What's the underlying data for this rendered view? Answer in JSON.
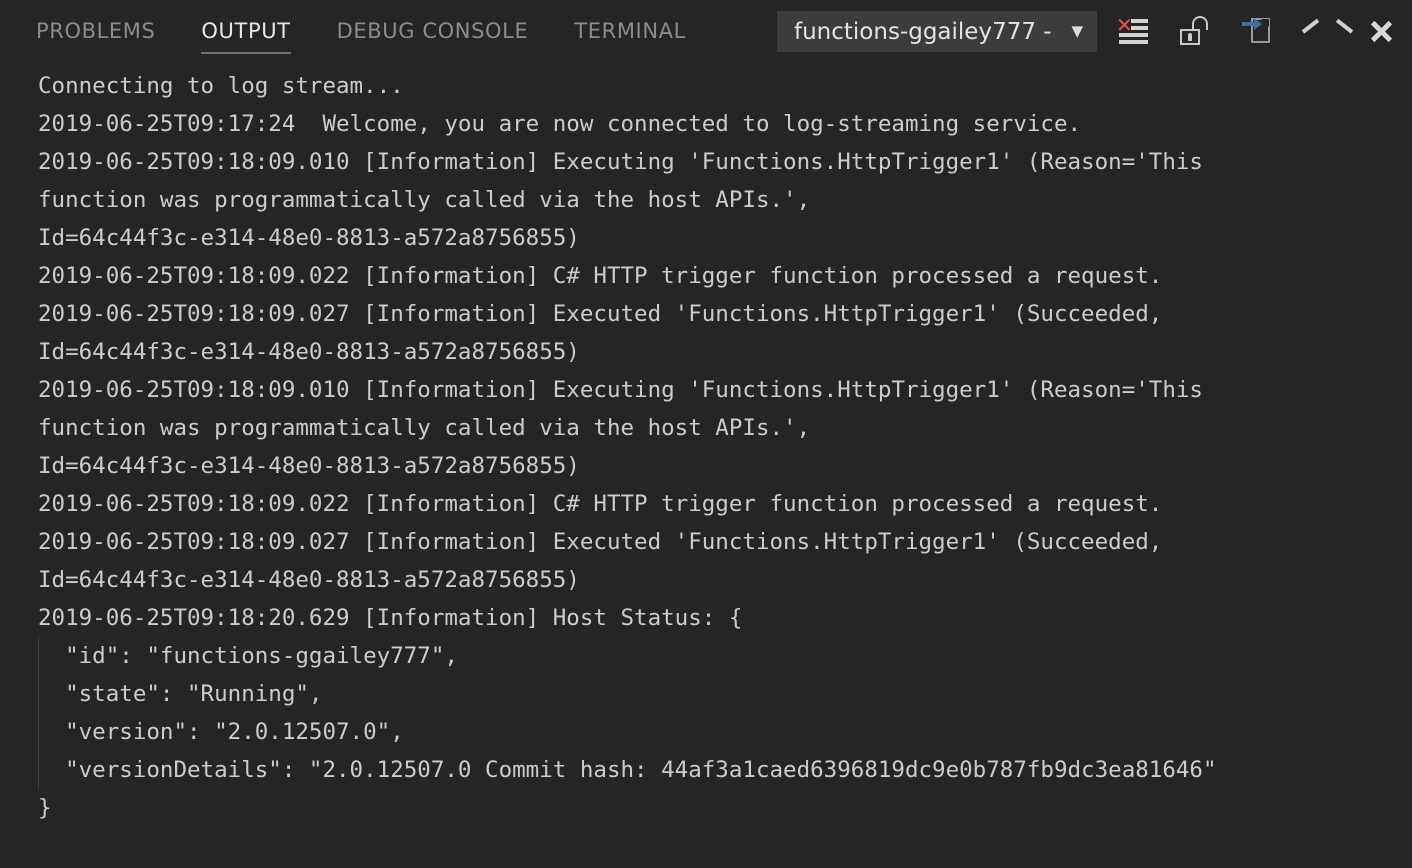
{
  "panel": {
    "tabs": [
      {
        "label": "PROBLEMS",
        "active": false
      },
      {
        "label": "OUTPUT",
        "active": true
      },
      {
        "label": "DEBUG CONSOLE",
        "active": false
      },
      {
        "label": "TERMINAL",
        "active": false
      }
    ],
    "channel_select": {
      "value": "functions-ggailey777 - ",
      "chevron": "▼"
    },
    "toolbar": {
      "clear_output": "clear-output-icon",
      "lock_scroll": "unlock-icon",
      "open_in_editor": "open-in-editor-icon",
      "maximize_panel": "chevron-up-icon",
      "close_panel": "close-icon",
      "clear_x_glyph": "✕"
    },
    "colors": {
      "panel_background": "#252526",
      "dropdown_background": "#3c3c3c",
      "text": "#cccccc",
      "tab_inactive": "#8c8c8c",
      "tab_active": "#e7e7e7",
      "clear_x_red": "#f14c4c",
      "arrow_blue": "#3d6e9e",
      "indent_guide": "#404040"
    }
  },
  "output": {
    "lines": [
      {
        "text": "Connecting to log stream...",
        "indent": false
      },
      {
        "text": "2019-06-25T09:17:24  Welcome, you are now connected to log-streaming service.",
        "indent": false
      },
      {
        "text": "2019-06-25T09:18:09.010 [Information] Executing 'Functions.HttpTrigger1' (Reason='This",
        "indent": false
      },
      {
        "text": "function was programmatically called via the host APIs.',",
        "indent": false
      },
      {
        "text": "Id=64c44f3c-e314-48e0-8813-a572a8756855)",
        "indent": false
      },
      {
        "text": "2019-06-25T09:18:09.022 [Information] C# HTTP trigger function processed a request.",
        "indent": false
      },
      {
        "text": "2019-06-25T09:18:09.027 [Information] Executed 'Functions.HttpTrigger1' (Succeeded,",
        "indent": false
      },
      {
        "text": "Id=64c44f3c-e314-48e0-8813-a572a8756855)",
        "indent": false
      },
      {
        "text": "2019-06-25T09:18:09.010 [Information] Executing 'Functions.HttpTrigger1' (Reason='This",
        "indent": false
      },
      {
        "text": "function was programmatically called via the host APIs.',",
        "indent": false
      },
      {
        "text": "Id=64c44f3c-e314-48e0-8813-a572a8756855)",
        "indent": false
      },
      {
        "text": "2019-06-25T09:18:09.022 [Information] C# HTTP trigger function processed a request.",
        "indent": false
      },
      {
        "text": "2019-06-25T09:18:09.027 [Information] Executed 'Functions.HttpTrigger1' (Succeeded,",
        "indent": false
      },
      {
        "text": "Id=64c44f3c-e314-48e0-8813-a572a8756855)",
        "indent": false
      },
      {
        "text": "2019-06-25T09:18:20.629 [Information] Host Status: {",
        "indent": false
      },
      {
        "text": "  \"id\": \"functions-ggailey777\",",
        "indent": true
      },
      {
        "text": "  \"state\": \"Running\",",
        "indent": true
      },
      {
        "text": "  \"version\": \"2.0.12507.0\",",
        "indent": true
      },
      {
        "text": "  \"versionDetails\": \"2.0.12507.0 Commit hash: 44af3a1caed6396819dc9e0b787fb9dc3ea81646\"",
        "indent": true
      },
      {
        "text": "}",
        "indent": false
      }
    ]
  }
}
